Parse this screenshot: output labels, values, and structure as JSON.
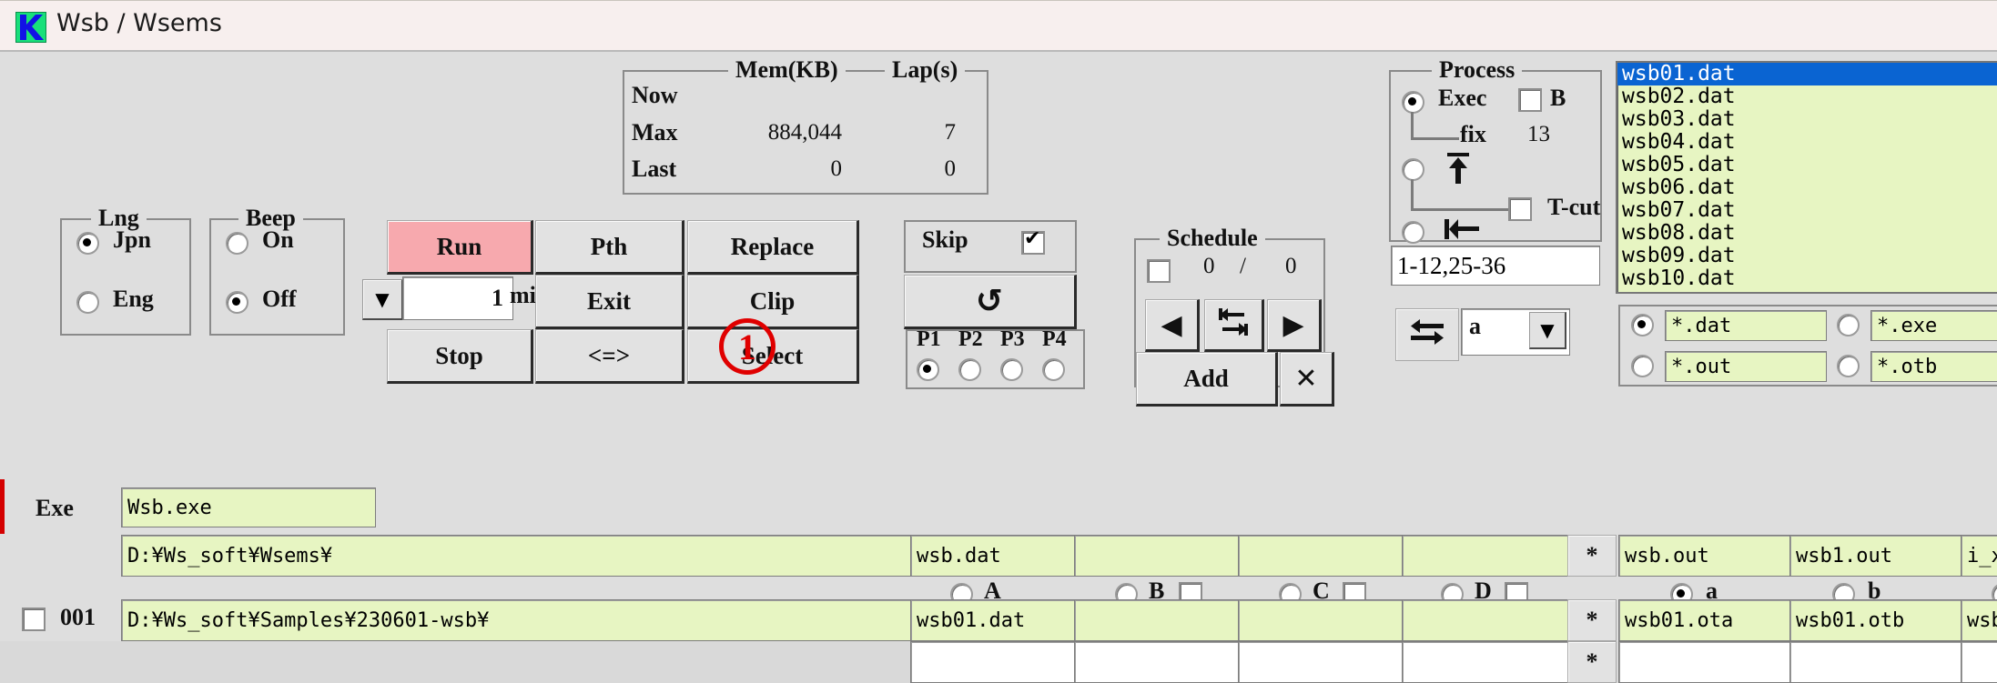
{
  "window": {
    "title": "Wsb / Wsems",
    "icon": "app-k-icon"
  },
  "mem_panel": {
    "title_mem": "Mem(KB)",
    "title_lap": "Lap(s)",
    "rows": [
      {
        "label": "Now",
        "mem": "",
        "lap": ""
      },
      {
        "label": "Max",
        "mem": "884,044",
        "lap": "7"
      },
      {
        "label": "Last",
        "mem": "0",
        "lap": "0"
      }
    ]
  },
  "process_panel": {
    "title": "Process",
    "exec_label": "Exec",
    "b_label": "B",
    "fix_label": "fix",
    "fix_value": "13",
    "tcut_label": "T-cut",
    "range_value": "1-12,25-36",
    "exec_selected": true,
    "b_checked": false,
    "tcut_checked": false
  },
  "lng_panel": {
    "title": "Lng",
    "options": [
      {
        "label": "Jpn",
        "selected": true
      },
      {
        "label": "Eng",
        "selected": false
      }
    ]
  },
  "beep_panel": {
    "title": "Beep",
    "options": [
      {
        "label": "On",
        "selected": false
      },
      {
        "label": "Off",
        "selected": true
      }
    ]
  },
  "buttons": {
    "run": "Run",
    "pth": "Pth",
    "replace": "Replace",
    "exit": "Exit",
    "clip": "Clip",
    "stop": "Stop",
    "swap": "<=>",
    "select": "Select",
    "refresh_icon": "↺",
    "min_value": "1",
    "min_label": "min",
    "spin_icon": "▼"
  },
  "skip_panel": {
    "label": "Skip",
    "checked": true
  },
  "p_panel": {
    "labels": [
      "P1",
      "P2",
      "P3",
      "P4"
    ],
    "selected_index": 0
  },
  "schedule_panel": {
    "title": "Schedule",
    "checked": false,
    "current": "0",
    "separator": "/",
    "total": "0",
    "prev_icon": "◀",
    "next_icon": "▶",
    "swap_icon": "swap-arrows-icon",
    "add_label": "Add",
    "close_icon": "✕"
  },
  "ab_swap": {
    "swap_icon": "left-right-arrows-icon",
    "combo_value": "a",
    "combo_arrow": "▼"
  },
  "file_list": {
    "items": [
      {
        "name": "wsb01.dat",
        "selected": true
      },
      {
        "name": "wsb02.dat",
        "selected": false
      },
      {
        "name": "wsb03.dat",
        "selected": false
      },
      {
        "name": "wsb04.dat",
        "selected": false
      },
      {
        "name": "wsb05.dat",
        "selected": false
      },
      {
        "name": "wsb06.dat",
        "selected": false
      },
      {
        "name": "wsb07.dat",
        "selected": false
      },
      {
        "name": "wsb08.dat",
        "selected": false
      },
      {
        "name": "wsb09.dat",
        "selected": false
      },
      {
        "name": "wsb10.dat",
        "selected": false
      }
    ]
  },
  "filters": [
    {
      "label": "*.dat",
      "selected": true
    },
    {
      "label": "*.exe",
      "selected": false
    },
    {
      "label": "*.out",
      "selected": false
    },
    {
      "label": "*.otb",
      "selected": false
    }
  ],
  "exe_row": {
    "label": "Exe",
    "value": "Wsb.exe"
  },
  "header_row": {
    "path": "D:¥Ws_soft¥Wsems¥",
    "inputs": [
      "wsb.dat",
      "",
      "",
      ""
    ],
    "star": "*",
    "outputs": [
      "wsb.out",
      "wsb1.out",
      "i_xz"
    ]
  },
  "abcd_row": {
    "items": [
      {
        "label": "A",
        "selected": false,
        "has_checkbox": false,
        "checked": false
      },
      {
        "label": "B",
        "selected": false,
        "has_checkbox": true,
        "checked": false
      },
      {
        "label": "C",
        "selected": false,
        "has_checkbox": true,
        "checked": false
      },
      {
        "label": "D",
        "selected": false,
        "has_checkbox": true,
        "checked": false
      }
    ],
    "ab_items": [
      {
        "label": "a",
        "selected": true
      },
      {
        "label": "b",
        "selected": false
      }
    ]
  },
  "data_rows": [
    {
      "checked": false,
      "index": "001",
      "path": "D:¥Ws_soft¥Samples¥230601-wsb¥",
      "inputs": [
        "wsb01.dat",
        "",
        "",
        ""
      ],
      "star": "*",
      "outputs": [
        "wsb01.ota",
        "wsb01.otb",
        "wsb"
      ]
    },
    {
      "checked": false,
      "index": "",
      "path": "",
      "inputs": [
        "",
        "",
        "",
        ""
      ],
      "star": "*",
      "outputs": [
        "",
        "",
        ""
      ]
    }
  ],
  "annotation": {
    "badge": "1"
  },
  "colors": {
    "run_button": "#f7a9ae",
    "field_bg": "#e7f5c2",
    "selection": "#0a64d2",
    "annotation": "#e00000"
  }
}
